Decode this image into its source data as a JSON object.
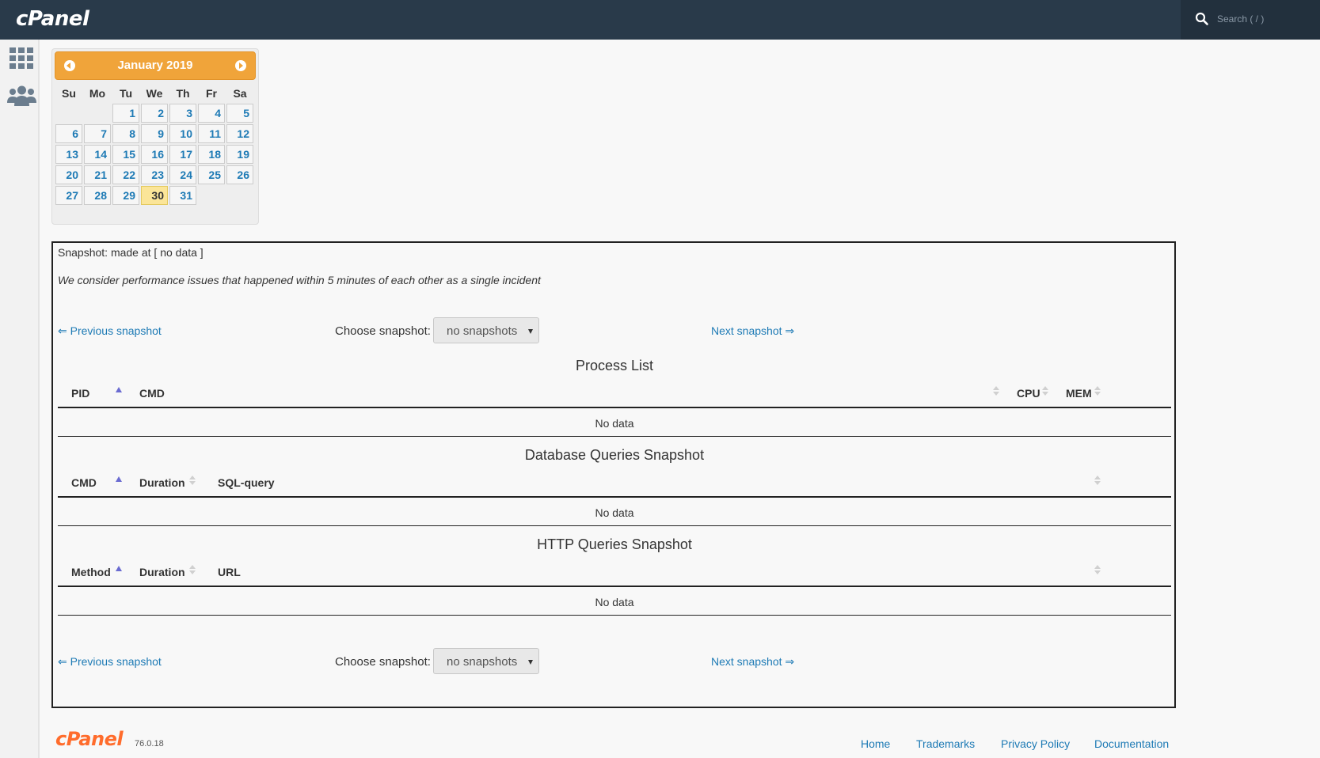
{
  "header": {
    "logo_text": "cPanel",
    "search_placeholder": "Search ( / )"
  },
  "sidebar": {
    "items": [
      {
        "icon": "grid-icon"
      },
      {
        "icon": "users-icon"
      }
    ]
  },
  "calendar": {
    "month_label": "January 2019",
    "weekdays": [
      "Su",
      "Mo",
      "Tu",
      "We",
      "Th",
      "Fr",
      "Sa"
    ],
    "weeks": [
      [
        "",
        "",
        "1",
        "2",
        "3",
        "4",
        "5"
      ],
      [
        "6",
        "7",
        "8",
        "9",
        "10",
        "11",
        "12"
      ],
      [
        "13",
        "14",
        "15",
        "16",
        "17",
        "18",
        "19"
      ],
      [
        "20",
        "21",
        "22",
        "23",
        "24",
        "25",
        "26"
      ],
      [
        "27",
        "28",
        "29",
        "30",
        "31",
        "",
        ""
      ]
    ],
    "selected_day": "30"
  },
  "snapshot": {
    "made_at": "Snapshot: made at [ no data ]",
    "note": "We consider performance issues that happened within 5 minutes of each other as a single incident"
  },
  "nav": {
    "prev": "⇐ Previous snapshot",
    "choose_label": "Choose snapshot:",
    "select_value": "no snapshots",
    "next": "Next snapshot ⇒"
  },
  "process_list": {
    "title": "Process List",
    "columns": [
      "PID",
      "CMD",
      "CPU",
      "MEM"
    ],
    "empty": "No data"
  },
  "db_queries": {
    "title": "Database Queries Snapshot",
    "columns": [
      "CMD",
      "Duration",
      "SQL-query"
    ],
    "empty": "No data"
  },
  "http_queries": {
    "title": "HTTP Queries Snapshot",
    "columns": [
      "Method",
      "Duration",
      "URL"
    ],
    "empty": "No data"
  },
  "footer": {
    "logo_text": "cPanel",
    "version": "76.0.18",
    "links": [
      "Home",
      "Trademarks",
      "Privacy Policy",
      "Documentation"
    ]
  },
  "colors": {
    "topbar": "#293a4a",
    "accent_orange": "#f0a43a",
    "link_blue": "#1d7ab5",
    "today_highlight": "#fbe598",
    "sort_active": "#6a6bd1"
  }
}
